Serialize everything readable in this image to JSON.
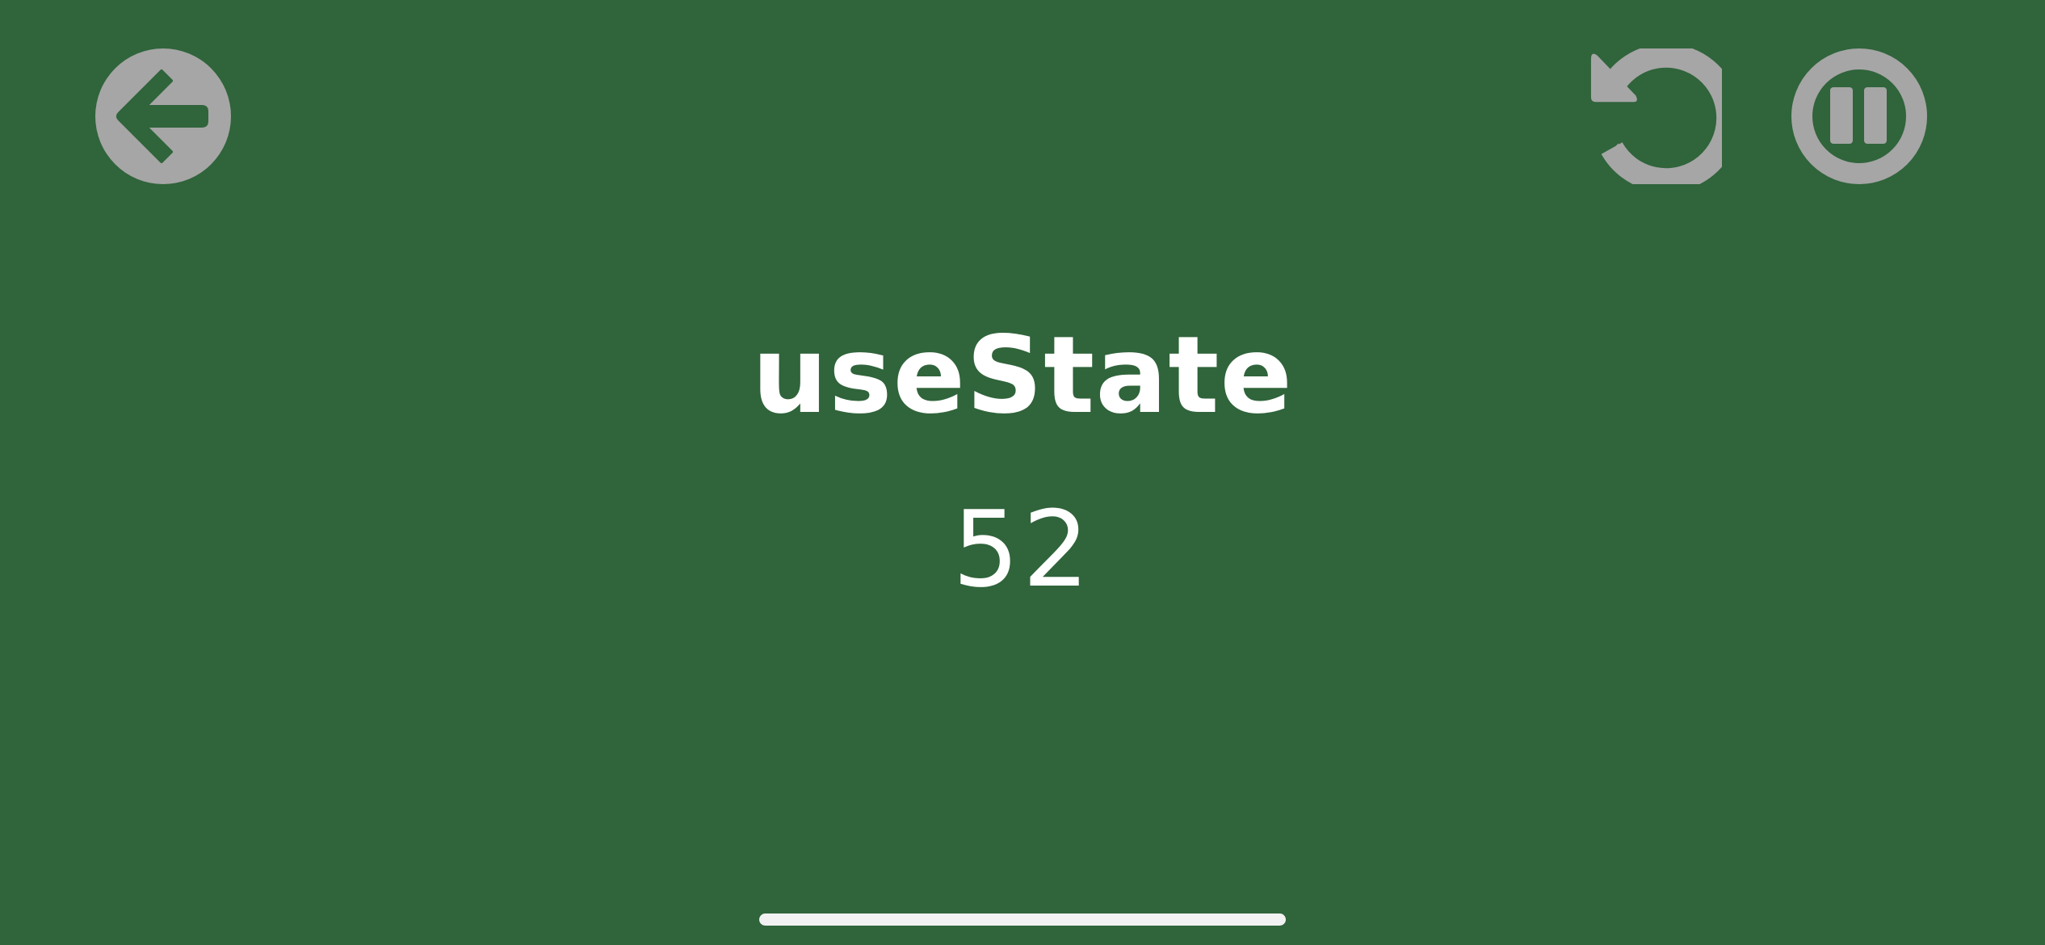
{
  "screen": {
    "background_color": "#30643b",
    "control_color": "#a6a6a6",
    "text_color": "#ffffff"
  },
  "controls": {
    "back": {
      "icon": "arrow-left-circle-icon"
    },
    "restart": {
      "icon": "counterclockwise-restart-icon"
    },
    "pause": {
      "icon": "pause-circle-icon"
    }
  },
  "content": {
    "title": "useState",
    "value": "52"
  }
}
